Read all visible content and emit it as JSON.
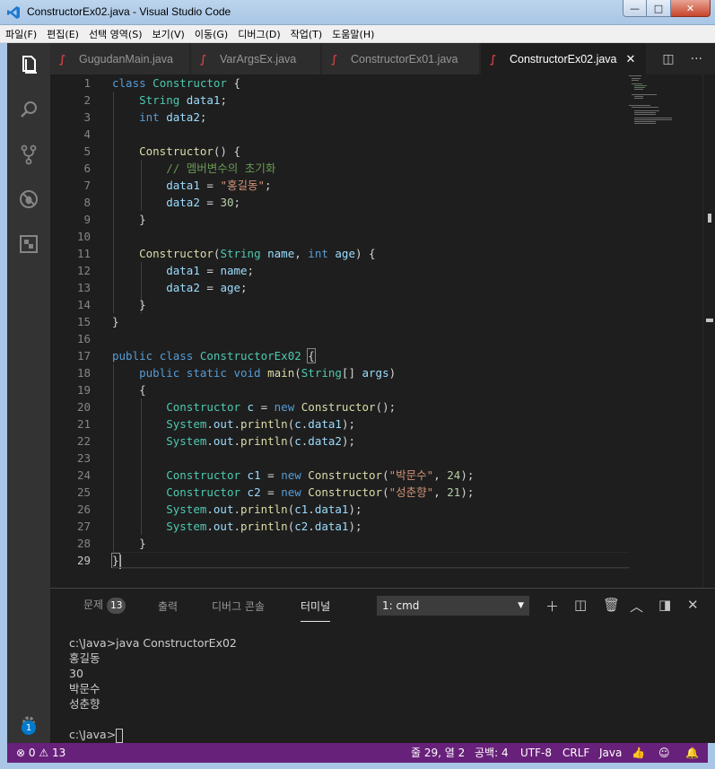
{
  "window": {
    "title": "ConstructorEx02.java - Visual Studio Code",
    "minimize": "—",
    "maximize": "□",
    "close": "✕"
  },
  "menu": [
    "파일(F)",
    "편집(E)",
    "선택 영역(S)",
    "보기(V)",
    "이동(G)",
    "디버그(D)",
    "작업(T)",
    "도움말(H)"
  ],
  "activity": {
    "settings_badge": "1"
  },
  "tabs": [
    {
      "label": "GugudanMain.java"
    },
    {
      "label": "VarArgsEx.java"
    },
    {
      "label": "ConstructorEx01.java"
    },
    {
      "label": "ConstructorEx02.java",
      "active": true
    }
  ],
  "editor": {
    "line_numbers": [
      "1",
      "2",
      "3",
      "4",
      "5",
      "6",
      "7",
      "8",
      "9",
      "10",
      "11",
      "12",
      "13",
      "14",
      "15",
      "16",
      "17",
      "18",
      "19",
      "20",
      "21",
      "22",
      "23",
      "24",
      "25",
      "26",
      "27",
      "28",
      "29"
    ],
    "current_line": "29"
  },
  "panel": {
    "tabs": {
      "problems": "문제",
      "problems_count": "13",
      "output": "출력",
      "debug_console": "디버그 콘솔",
      "terminal": "터미널"
    },
    "terminal_select": "1: cmd",
    "terminal_lines": [
      "c:\\Java>java ConstructorEx02",
      "홍길동",
      "30",
      "박문수",
      "성춘향",
      "",
      "c:\\Java>"
    ]
  },
  "status": {
    "errors": "0",
    "warnings": "13",
    "position": "줄 29, 열 2",
    "indent": "공백: 4",
    "encoding": "UTF-8",
    "eol": "CRLF",
    "language": "Java"
  },
  "colors": {
    "statusbar": "#68217a",
    "editor_bg": "#1e1e1e",
    "keyword": "#569cd6",
    "type": "#4ec9b0",
    "string": "#ce9178",
    "comment": "#6a9955"
  }
}
